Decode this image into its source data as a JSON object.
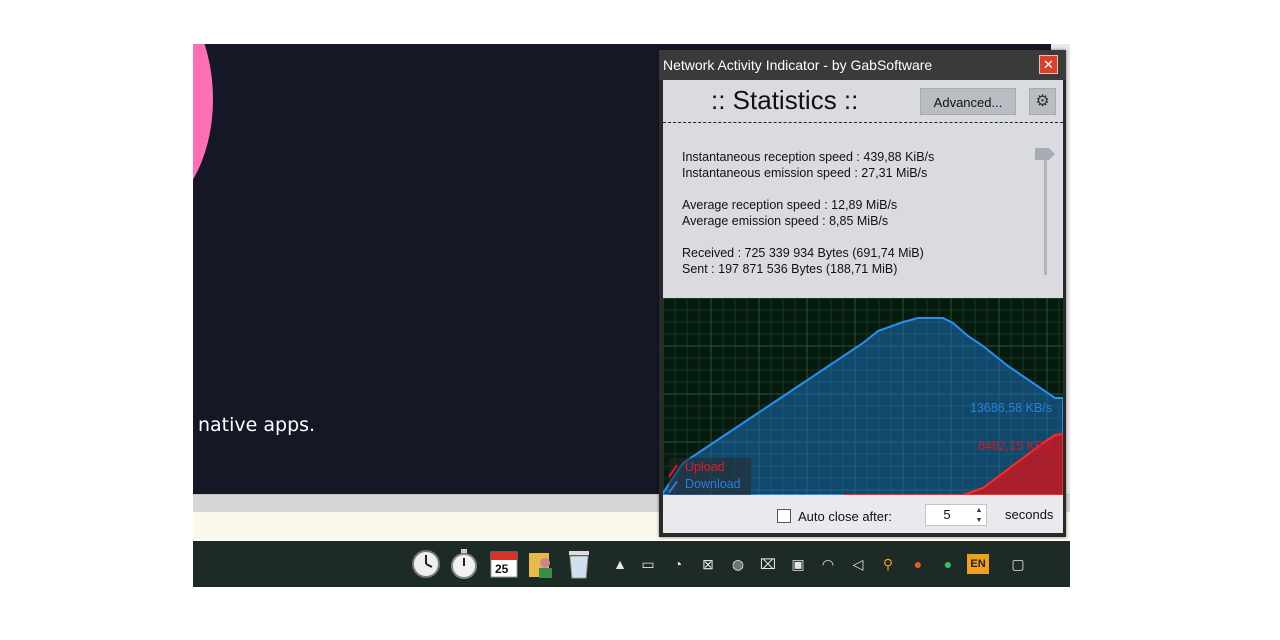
{
  "background_app": {
    "text": "native apps."
  },
  "widget": {
    "title": "Network Activity Indicator - by GabSoftware",
    "close_icon": "close-icon",
    "heading": ":: Statistics ::",
    "advanced_label": "Advanced...",
    "stats": {
      "inst_reception": "Instantaneous reception speed : 439,88 KiB/s",
      "inst_emission": "Instantaneous emission speed : 27,31 MiB/s",
      "avg_reception": "Average reception speed : 12,89 MiB/s",
      "avg_emission": "Average emission speed : 8,85 MiB/s",
      "received": "Received : 725 339 934 Bytes (691,74 MiB)",
      "sent": "Sent : 197 871 536 Bytes (188,71 MiB)"
    },
    "graph": {
      "download_speed_label": "13686,58 KB/s",
      "upload_speed_label": "8482,15 KB/s",
      "legend_upload": "Upload",
      "legend_download": "Download",
      "colors": {
        "download": "#2a7fe0",
        "upload": "#e01b2a",
        "grid": "#1f5a3a",
        "background": "#061a0e"
      }
    },
    "auto_close": {
      "label": "Auto close after:",
      "checked": false,
      "value": "5",
      "unit": "seconds"
    }
  },
  "taskbar": {
    "icons": [
      "clock-icon",
      "stopwatch-icon",
      "calendar-icon",
      "user-folder-icon",
      "recycle-bin-icon"
    ],
    "calendar_day": "25",
    "tray": [
      "chevron-up-icon",
      "battery-icon",
      "network-monitor-icon",
      "close-app-icon",
      "browser-icon",
      "usb-icon",
      "display-icon",
      "wifi-icon",
      "volume-icon",
      "search-icon",
      "firefox-icon",
      "green-status-icon",
      "language-icon",
      "notification-icon"
    ],
    "language": "EN"
  }
}
